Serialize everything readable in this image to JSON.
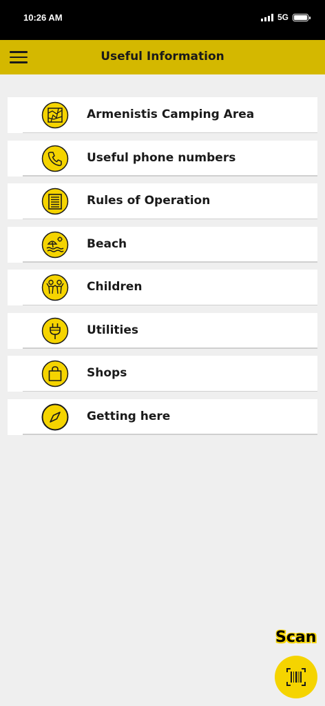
{
  "status_bar": {
    "time": "10:26 AM",
    "network": "5G"
  },
  "app_bar": {
    "title": "Useful Information",
    "menu_icon": "hamburger-menu-icon"
  },
  "menu_items": [
    {
      "label": "Armenistis Camping Area",
      "icon": "map-icon"
    },
    {
      "label": "Useful phone numbers",
      "icon": "phone-icon"
    },
    {
      "label": "Rules of Operation",
      "icon": "document-icon"
    },
    {
      "label": "Beach",
      "icon": "beach-icon"
    },
    {
      "label": "Children",
      "icon": "children-icon"
    },
    {
      "label": "Utilities",
      "icon": "plug-icon"
    },
    {
      "label": "Shops",
      "icon": "shopping-bag-icon"
    },
    {
      "label": "Getting here",
      "icon": "compass-icon"
    }
  ],
  "scan": {
    "label": "Scan",
    "icon": "barcode-scan-icon"
  },
  "colors": {
    "accent": "#d4b800",
    "icon_fill": "#f5d400",
    "background": "#efefef"
  }
}
